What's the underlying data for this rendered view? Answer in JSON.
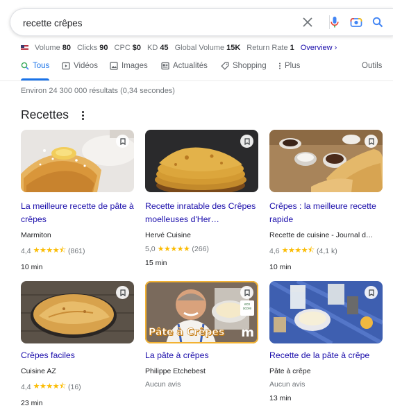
{
  "search": {
    "query": "recette crêpes"
  },
  "seo_bar": {
    "volume_label": "Volume",
    "volume": "80",
    "clicks_label": "Clicks",
    "clicks": "90",
    "cpc_label": "CPC",
    "cpc": "$0",
    "kd_label": "KD",
    "kd": "45",
    "global_label": "Global Volume",
    "global": "15K",
    "return_label": "Return Rate",
    "return": "1",
    "overview": "Overview ›"
  },
  "tabs": [
    {
      "label": "Tous",
      "icon": "search-icon"
    },
    {
      "label": "Vidéos",
      "icon": "video-icon"
    },
    {
      "label": "Images",
      "icon": "image-icon"
    },
    {
      "label": "Actualités",
      "icon": "news-icon"
    },
    {
      "label": "Shopping",
      "icon": "tag-icon"
    },
    {
      "label": "Plus",
      "icon": "more-vert-icon"
    }
  ],
  "tools_label": "Outils",
  "results_count": "Environ 24 300 000 résultats (0,34 secondes)",
  "section_title": "Recettes",
  "recipes": [
    {
      "title": "La meilleure recette de pâte à crêpes",
      "source": "Marmiton",
      "rating": "4,4",
      "stars": "★★★★⯪",
      "reviews": "(861)",
      "time": "10 min"
    },
    {
      "title": "Recette inratable des Crêpes moelleuses d'Her…",
      "source": "Hervé Cuisine",
      "rating": "5,0",
      "stars": "★★★★★",
      "reviews": "(266)",
      "time": "15 min"
    },
    {
      "title": "Crêpes : la meilleure recette rapide",
      "source": "Recette de cuisine - Journal d…",
      "rating": "4,6",
      "stars": "★★★★⯪",
      "reviews": "(4,1 k)",
      "time": "10 min"
    },
    {
      "title": "Crêpes faciles",
      "source": "Cuisine AZ",
      "rating": "4,4",
      "stars": "★★★★⯪",
      "reviews": "(16)",
      "time": "23 min"
    },
    {
      "title": "La pâte à crêpes",
      "source": "Philippe Etchebest",
      "no_reviews": "Aucun avis",
      "thumb_caption": "Pâte à Crêpes",
      "badge_text": "eco score"
    },
    {
      "title": "Recette de la pâte à crêpe",
      "source": "Pâte à crêpe",
      "no_reviews": "Aucun avis",
      "time": "13 min"
    }
  ],
  "colors": {
    "link": "#1a0dab",
    "accent": "#1a73e8",
    "star": "#fbbc04",
    "muted": "#70757a"
  }
}
